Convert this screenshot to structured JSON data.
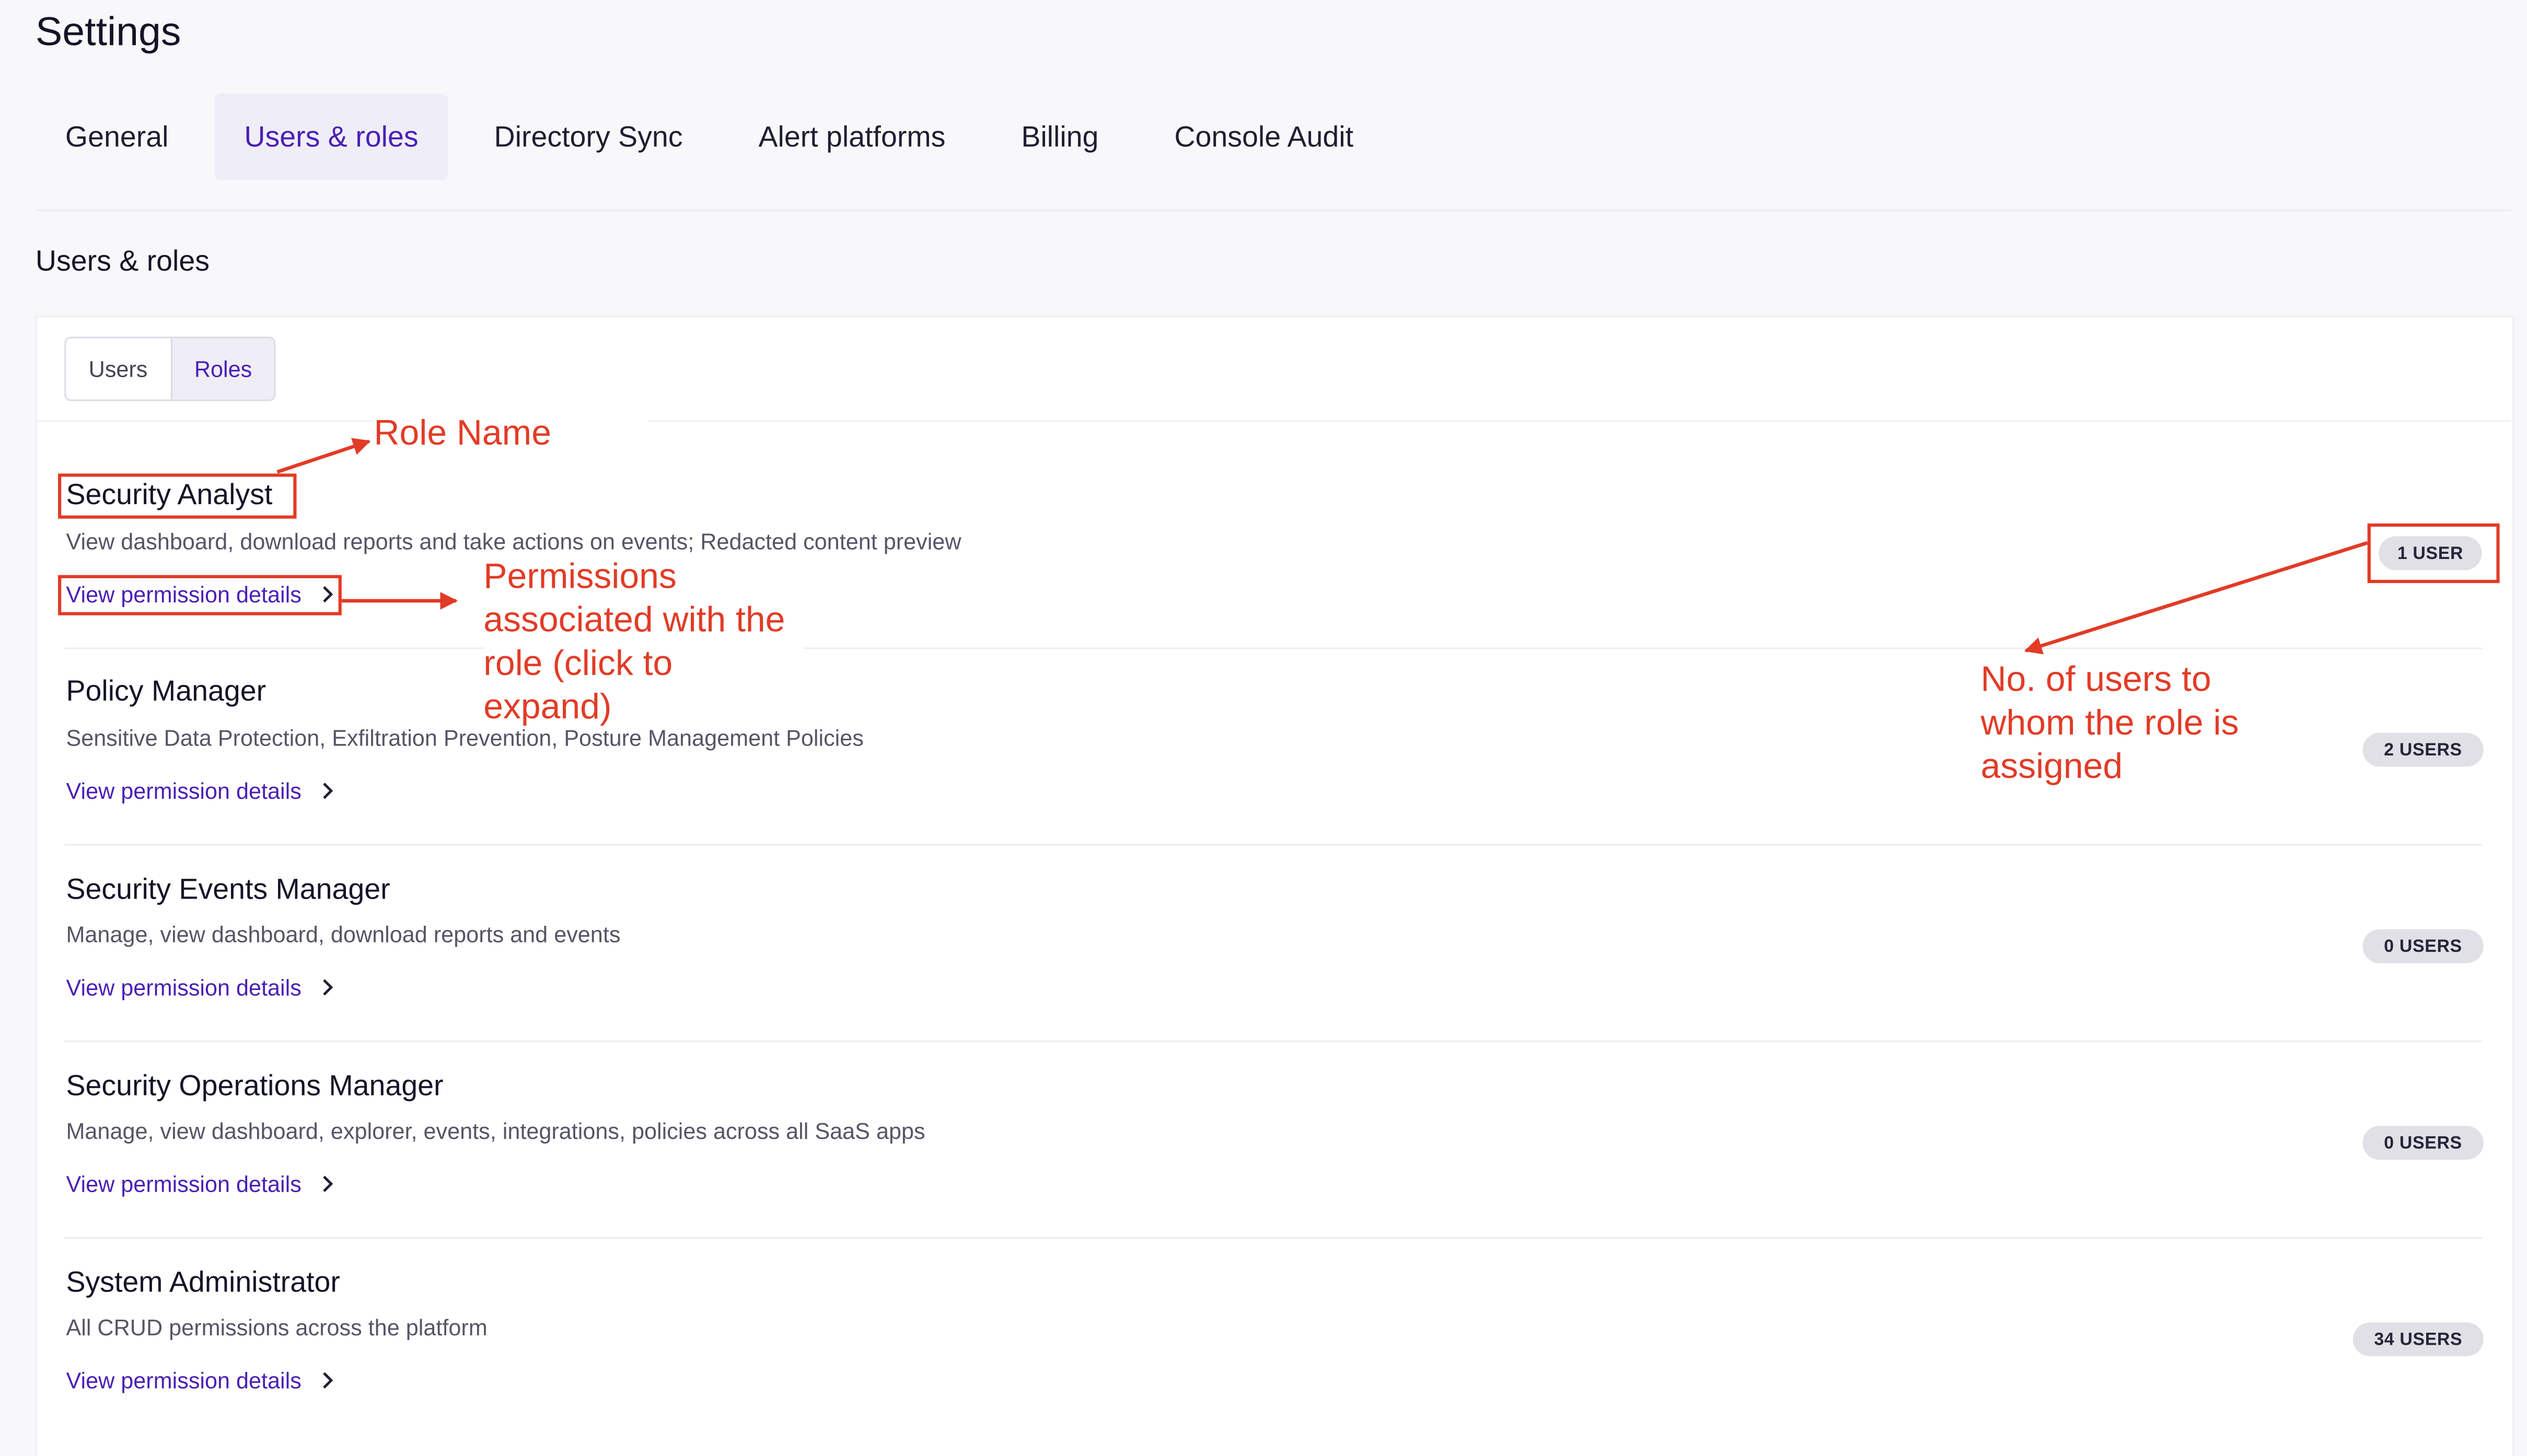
{
  "page": {
    "title": "Settings"
  },
  "tabs": [
    {
      "label": "General",
      "active": false
    },
    {
      "label": "Users & roles",
      "active": true
    },
    {
      "label": "Directory Sync",
      "active": false
    },
    {
      "label": "Alert platforms",
      "active": false
    },
    {
      "label": "Billing",
      "active": false
    },
    {
      "label": "Console Audit",
      "active": false
    }
  ],
  "section": {
    "title": "Users & roles"
  },
  "segmented": {
    "users_label": "Users",
    "roles_label": "Roles",
    "active": "Roles"
  },
  "roles": [
    {
      "name": "Security Analyst",
      "description": "View dashboard, download reports and take actions on events; Redacted content preview",
      "link": "View permission details",
      "users": "1 USER"
    },
    {
      "name": "Policy Manager",
      "description": "Sensitive Data Protection, Exfiltration Prevention, Posture Management Policies",
      "link": "View permission details",
      "users": "2 USERS"
    },
    {
      "name": "Security Events Manager",
      "description": "Manage, view dashboard, download reports and events",
      "link": "View permission details",
      "users": "0 USERS"
    },
    {
      "name": "Security Operations Manager",
      "description": "Manage, view dashboard, explorer, events, integrations, policies across all SaaS apps",
      "link": "View permission details",
      "users": "0 USERS"
    },
    {
      "name": "System Administrator",
      "description": "All CRUD permissions across the platform",
      "link": "View permission details",
      "users": "34 USERS"
    }
  ],
  "annotations": {
    "role_name": "Role Name",
    "permissions": [
      "Permissions",
      "associated with the",
      "role (click to",
      "expand)"
    ],
    "users_count": [
      "No. of users to",
      "whom the role is",
      "assigned"
    ],
    "color": "#e23b26"
  },
  "colors": {
    "accent": "#4a1fb5",
    "active_tab_bg": "#efeef7",
    "badge_bg": "#e0e0e6"
  }
}
